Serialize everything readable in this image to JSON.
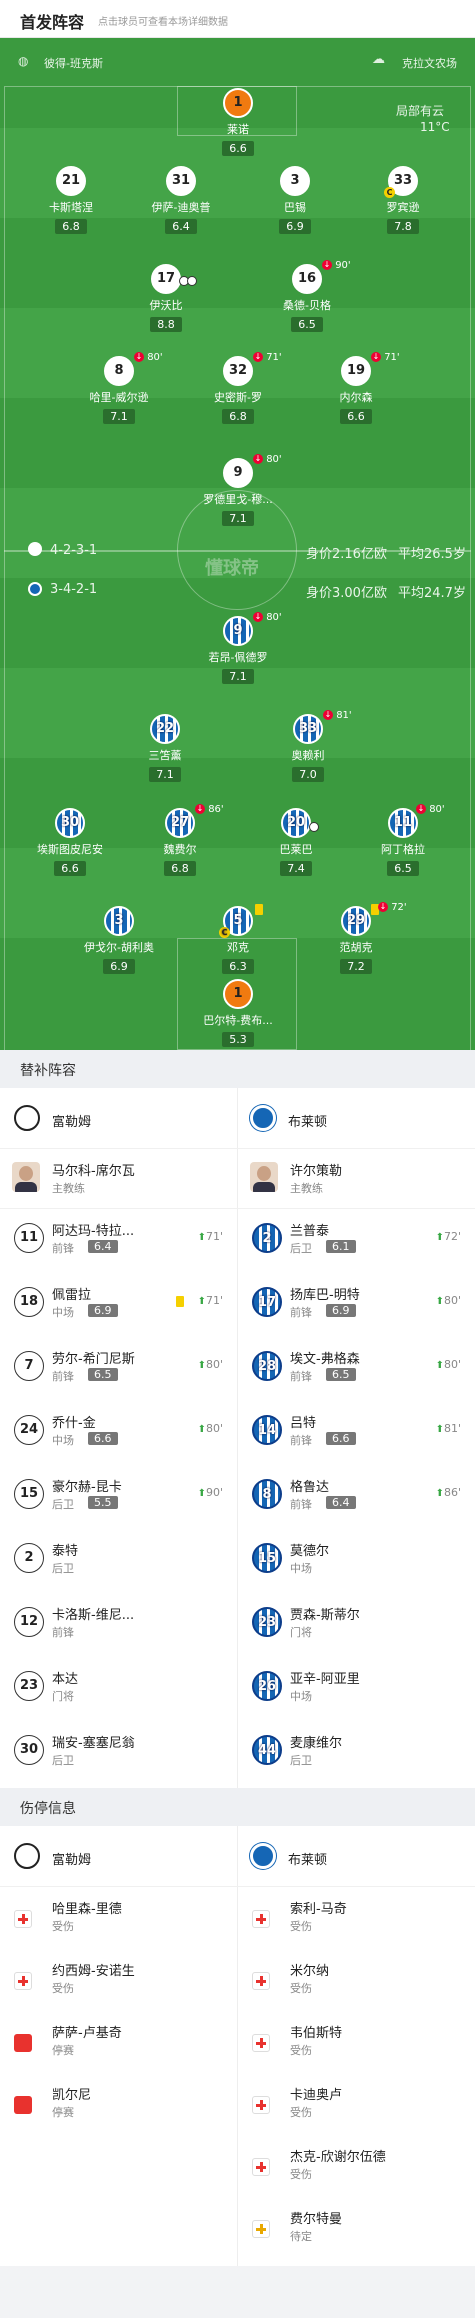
{
  "header": {
    "title": "首发阵容",
    "hint": "点击球员可查看本场详细数据"
  },
  "pitch": {
    "home_team": "彼得-班克斯",
    "away_team": "克拉文农场",
    "weather": "局部有云",
    "temperature": "11°C",
    "watermark": "懂球帝",
    "fulham": {
      "formation": "4-2-3-1",
      "value": "身价2.16亿欧",
      "age": "平均26.5岁"
    },
    "brighton": {
      "formation": "3-4-2-1",
      "value": "身价3.00亿欧",
      "age": "平均24.7岁"
    },
    "players": [
      {
        "num": "1",
        "name": "莱诺",
        "rating": "6.6"
      },
      {
        "num": "21",
        "name": "卡斯塔涅",
        "rating": "6.8"
      },
      {
        "num": "31",
        "name": "伊萨-迪奥普",
        "rating": "6.4"
      },
      {
        "num": "3",
        "name": "巴锡",
        "rating": "6.9"
      },
      {
        "num": "33",
        "name": "罗宾逊",
        "rating": "7.8"
      },
      {
        "num": "17",
        "name": "伊沃比",
        "rating": "8.8",
        "ev": "⚽⚽"
      },
      {
        "num": "16",
        "name": "桑德-贝格",
        "rating": "6.5",
        "ev": "90'"
      },
      {
        "num": "8",
        "name": "哈里-威尔逊",
        "rating": "7.1",
        "ev": "80'"
      },
      {
        "num": "32",
        "name": "史密斯-罗",
        "rating": "6.8",
        "ev": "71'"
      },
      {
        "num": "19",
        "name": "内尔森",
        "rating": "6.6",
        "ev": "71'"
      },
      {
        "num": "9",
        "name": "罗德里戈-穆...",
        "rating": "7.1",
        "ev": "80'"
      },
      {
        "num": "9",
        "name": "若昂-佩德罗",
        "rating": "7.1",
        "ev": "80'"
      },
      {
        "num": "22",
        "name": "三笘薰",
        "rating": "7.1"
      },
      {
        "num": "33",
        "name": "奥赖利",
        "rating": "7.0",
        "ev": "81'"
      },
      {
        "num": "30",
        "name": "埃斯图皮尼安",
        "rating": "6.6"
      },
      {
        "num": "27",
        "name": "魏费尔",
        "rating": "6.8",
        "ev": "86'"
      },
      {
        "num": "20",
        "name": "巴莱巴",
        "rating": "7.4"
      },
      {
        "num": "11",
        "name": "阿丁格拉",
        "rating": "6.5",
        "ev": "80'"
      },
      {
        "num": "3",
        "name": "伊戈尔-胡利奥",
        "rating": "6.9"
      },
      {
        "num": "5",
        "name": "邓克",
        "rating": "6.3"
      },
      {
        "num": "29",
        "name": "范胡克",
        "rating": "7.2",
        "ev": "72'"
      },
      {
        "num": "1",
        "name": "巴尔特-费布...",
        "rating": "5.3"
      }
    ]
  },
  "subs": {
    "title": "替补阵容",
    "home_team": "富勒姆",
    "away_team": "布莱顿",
    "home_coach": {
      "name": "马尔科-席尔瓦",
      "role": "主教练"
    },
    "away_coach": {
      "name": "许尔策勒",
      "role": "主教练"
    },
    "home": [
      {
        "num": "11",
        "name": "阿达玛-特拉...",
        "pos": "前锋",
        "rating": "6.4",
        "min": "71'"
      },
      {
        "num": "18",
        "name": "佩雷拉",
        "pos": "中场",
        "rating": "6.9",
        "min": "71'"
      },
      {
        "num": "7",
        "name": "劳尔-希门尼斯",
        "pos": "前锋",
        "rating": "6.5",
        "min": "80'"
      },
      {
        "num": "24",
        "name": "乔什-金",
        "pos": "中场",
        "rating": "6.6",
        "min": "80'"
      },
      {
        "num": "15",
        "name": "豪尔赫-昆卡",
        "pos": "后卫",
        "rating": "5.5",
        "min": "90'"
      },
      {
        "num": "2",
        "name": "泰特",
        "pos": "后卫"
      },
      {
        "num": "12",
        "name": "卡洛斯-维尼...",
        "pos": "前锋"
      },
      {
        "num": "23",
        "name": "本达",
        "pos": "门将"
      },
      {
        "num": "30",
        "name": "瑞安-塞塞尼翁",
        "pos": "后卫"
      }
    ],
    "away": [
      {
        "num": "2",
        "name": "兰普泰",
        "pos": "后卫",
        "rating": "6.1",
        "min": "72'"
      },
      {
        "num": "17",
        "name": "扬库巴-明特",
        "pos": "前锋",
        "rating": "6.9",
        "min": "80'"
      },
      {
        "num": "28",
        "name": "埃文-弗格森",
        "pos": "前锋",
        "rating": "6.5",
        "min": "80'"
      },
      {
        "num": "14",
        "name": "吕特",
        "pos": "前锋",
        "rating": "6.6",
        "min": "81'"
      },
      {
        "num": "8",
        "name": "格鲁达",
        "pos": "前锋",
        "rating": "6.4",
        "min": "86'"
      },
      {
        "num": "15",
        "name": "莫德尔",
        "pos": "中场"
      },
      {
        "num": "23",
        "name": "贾森-斯蒂尔",
        "pos": "门将"
      },
      {
        "num": "26",
        "name": "亚辛-阿亚里",
        "pos": "中场"
      },
      {
        "num": "44",
        "name": "麦康维尔",
        "pos": "后卫"
      }
    ]
  },
  "injuries": {
    "title": "伤停信息",
    "home_team": "富勒姆",
    "away_team": "布莱顿",
    "home": [
      {
        "name": "哈里森-里德",
        "status": "受伤"
      },
      {
        "name": "约西姆-安诺生",
        "status": "受伤"
      },
      {
        "name": "萨萨-卢基奇",
        "status": "停赛"
      },
      {
        "name": "凯尔尼",
        "status": "停赛"
      }
    ],
    "away": [
      {
        "name": "索利-马奇",
        "status": "受伤"
      },
      {
        "name": "米尔纳",
        "status": "受伤"
      },
      {
        "name": "韦伯斯特",
        "status": "受伤"
      },
      {
        "name": "卡迪奥卢",
        "status": "受伤"
      },
      {
        "name": "杰克-欣谢尔伍德",
        "status": "受伤"
      },
      {
        "name": "费尔特曼",
        "status": "待定"
      }
    ]
  },
  "colors": {
    "pitch": "#3b9a3f",
    "fulham": "#ffffff",
    "brighton": "#1566b5",
    "goalkeeper": "#f07a10",
    "rating": "#2a6e2d"
  }
}
